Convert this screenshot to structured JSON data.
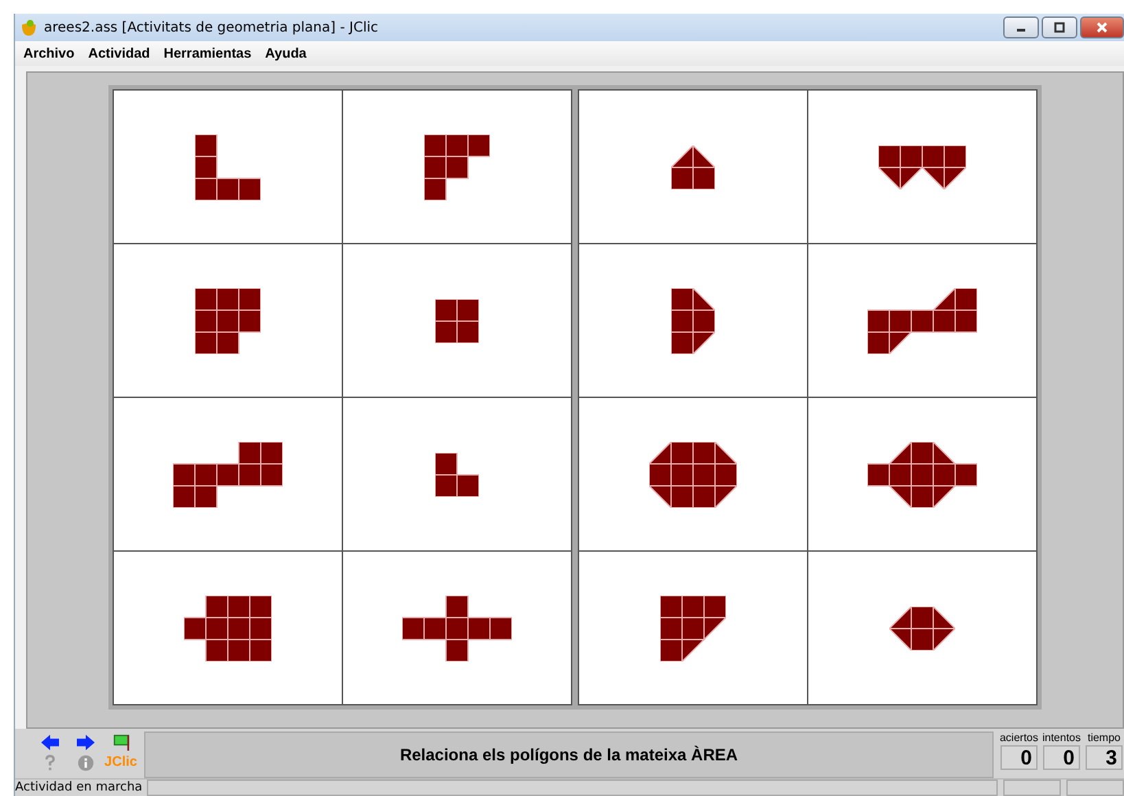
{
  "window": {
    "title": "arees2.ass [Activitats de geometria plana] - JClic"
  },
  "menu": [
    "Archivo",
    "Actividad",
    "Herramientas",
    "Ayuda"
  ],
  "message": "Relaciona els polígons de la mateixa ÀREA",
  "logo": "JClic",
  "counters": [
    {
      "label": "aciertos",
      "value": "0"
    },
    {
      "label": "intentos",
      "value": "0"
    },
    {
      "label": "tiempo",
      "value": "3"
    }
  ],
  "status_bar": {
    "text": "Actividad en marcha"
  }
}
